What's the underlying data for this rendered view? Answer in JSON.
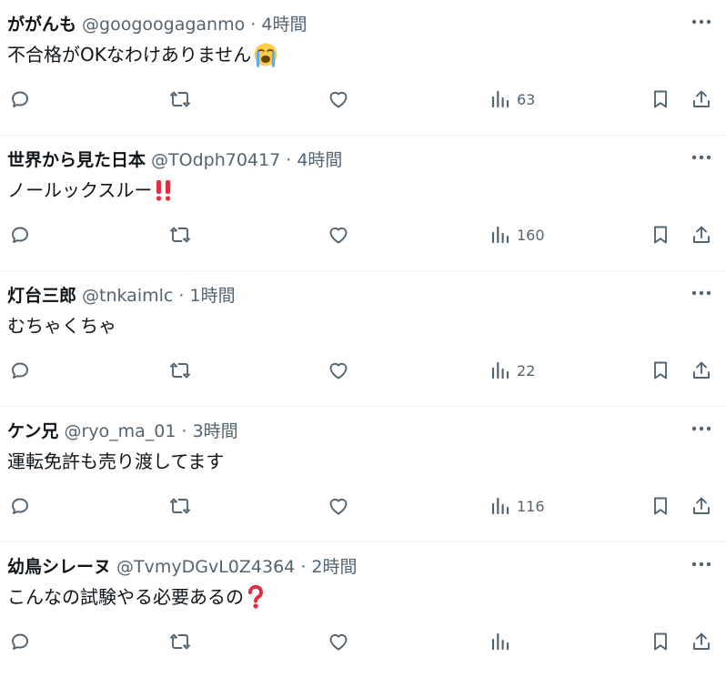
{
  "tweets": [
    {
      "name": "ががんも",
      "handle": "@googoogaganmo",
      "time": "4時間",
      "text": "不合格がOKなわけありません",
      "emoji": "loudly-crying-face",
      "views": "63"
    },
    {
      "name": "世界から見た日本",
      "handle": "@TOdph70417",
      "time": "4時間",
      "text": "ノールックスルー",
      "emoji": "double-exclamation",
      "views": "160"
    },
    {
      "name": "灯台三郎",
      "handle": "@tnkaimlc",
      "time": "1時間",
      "text": "むちゃくちゃ",
      "emoji": "",
      "views": "22"
    },
    {
      "name": "ケン兄",
      "handle": "@ryo_ma_01",
      "time": "3時間",
      "text": "運転免許も売り渡してます",
      "emoji": "",
      "views": "116"
    },
    {
      "name": "幼鳥シレーヌ",
      "handle": "@TvmyDGvL0Z4364",
      "time": "2時間",
      "text": "こんなの試験やる必要あるの",
      "emoji": "red-question-mark",
      "views": ""
    }
  ],
  "separator": "·",
  "colors": {
    "text": "#0f1419",
    "muted": "#536471",
    "border": "#eff3f4",
    "red": "#e0245e"
  }
}
